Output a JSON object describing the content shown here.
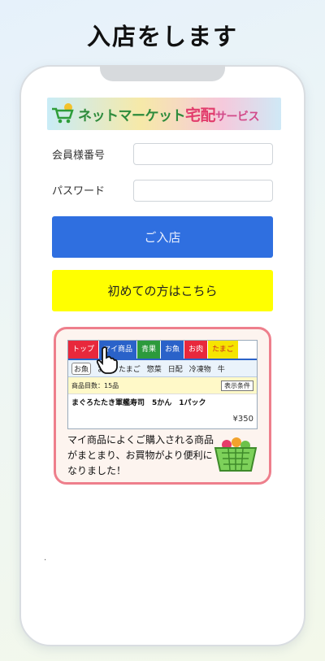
{
  "headline": "入店をします",
  "banner": {
    "text_part1": "ネットマーケット",
    "text_part2": "宅配",
    "text_part3": "サービス"
  },
  "form": {
    "member_label": "会員様番号",
    "member_value": "",
    "password_label": "パスワード",
    "password_value": ""
  },
  "buttons": {
    "enter": "ご入店",
    "first_time": "初めての方はこちら"
  },
  "promo": {
    "tabs": [
      "トップ",
      "マイ商品",
      "青果",
      "お魚",
      "お肉",
      "たまご"
    ],
    "subnav": [
      "お魚",
      "お肉",
      "たまご",
      "惣菜",
      "日配",
      "冷凍物",
      "牛"
    ],
    "item_count": "商品目数：15品",
    "condition_button": "表示条件",
    "item_name": "まぐろたたき軍艦寿司　5かん　1パック",
    "item_price": "¥350",
    "message": "マイ商品によくご購入される商品がまとまり、お買物がより便利になりました！"
  },
  "colors": {
    "primary_button": "#2f6fe0",
    "secondary_button": "#ffff00",
    "promo_border": "#ee7f8c"
  }
}
